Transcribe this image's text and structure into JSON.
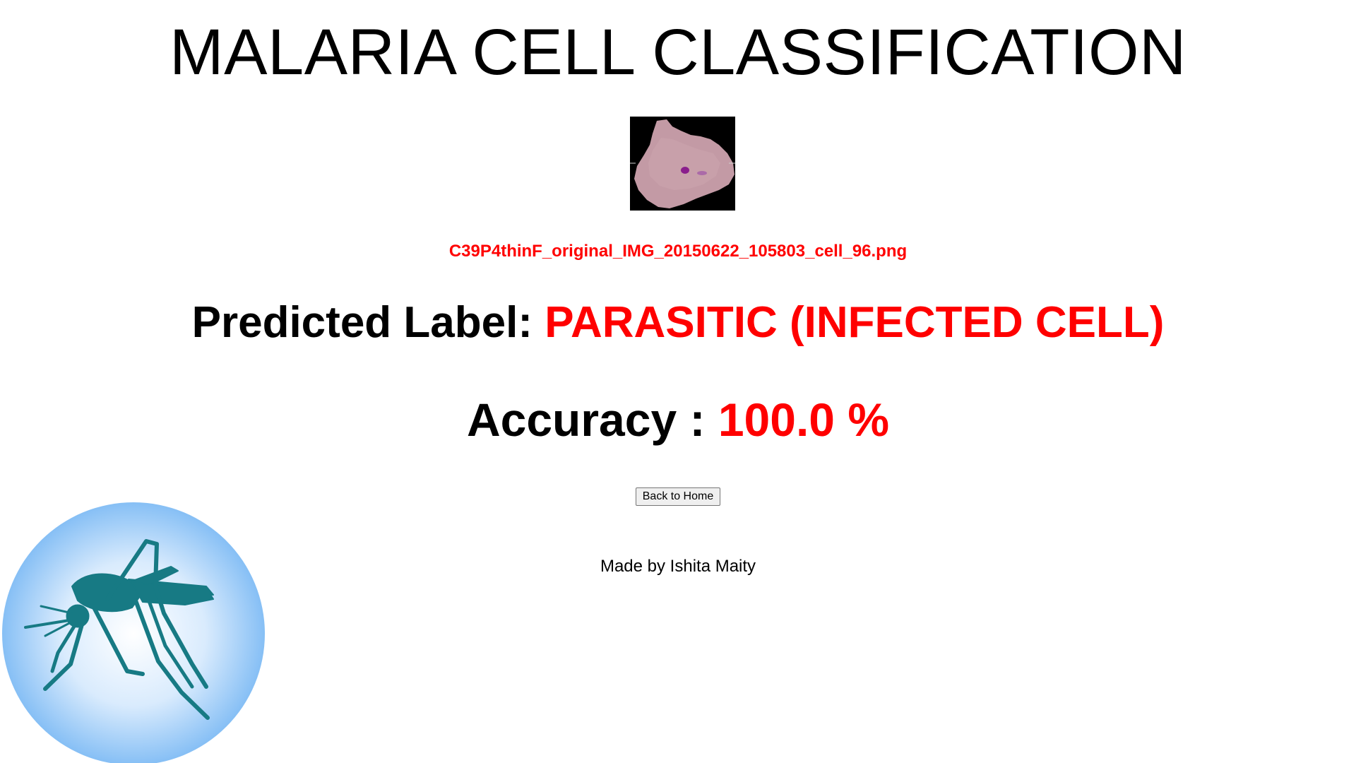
{
  "page": {
    "title": "MALARIA CELL CLASSIFICATION",
    "filename": "C39P4thinF_original_IMG_20150622_105803_cell_96.png",
    "prediction": {
      "label_prefix": "Predicted Label: ",
      "value": "PARASITIC (INFECTED CELL)"
    },
    "accuracy": {
      "label_prefix": "Accuracy : ",
      "value": "100.0 %"
    },
    "back_button_label": "Back to Home",
    "credit": "Made by Ishita Maity"
  },
  "colors": {
    "accent": "#ff0000",
    "text": "#000000",
    "mosquito": "#177a84",
    "logo_circle_edge": "#8fc4f6",
    "logo_circle_center": "#ffffff",
    "cell_fill": "#c89aa6",
    "cell_background": "#000000",
    "parasite": "#8a1e8c"
  },
  "icons": {
    "cell": "malaria-cell-image",
    "logo": "mosquito-icon"
  }
}
